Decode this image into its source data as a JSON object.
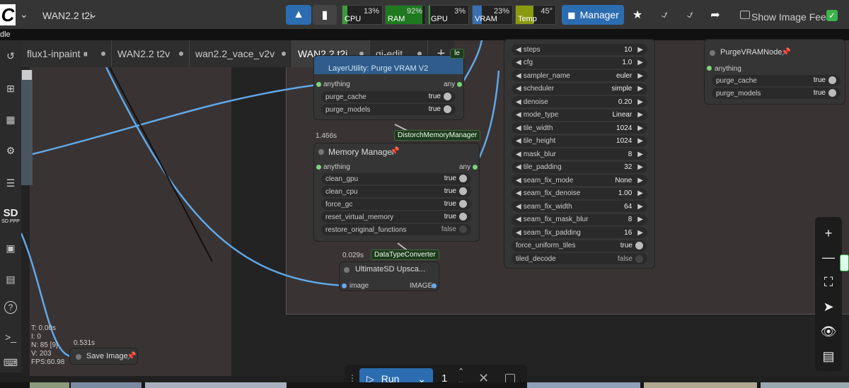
{
  "topbar": {
    "workflow_title": "WAN2.2 t2i",
    "manager_label": "Manager",
    "show_image_feed_label": "Show Image Feed",
    "meters": [
      {
        "label": "CPU",
        "value": "13%",
        "level": 0.13,
        "color": "#3a9a3a"
      },
      {
        "label": "RAM",
        "value": "92%",
        "level": 0.92,
        "color": "#1f7a1f"
      },
      {
        "label": "GPU",
        "value": "3%",
        "level": 0.03,
        "color": "#3a9a3a"
      },
      {
        "label": "VRAM",
        "value": "23%",
        "level": 0.23,
        "color": "#3a6fb0"
      },
      {
        "label": "Temp",
        "value": "45°",
        "level": 0.45,
        "color": "#8a9a10"
      }
    ],
    "strip_label": "dle"
  },
  "tabs": [
    {
      "label": "flux1-inpaint ⏸"
    },
    {
      "label": "WAN2.2 t2v"
    },
    {
      "label": "wan2.2_vace_v2v"
    },
    {
      "label": "WAN2.2 t2i"
    },
    {
      "label": "qi-edit"
    }
  ],
  "tab_add": "+",
  "sidebar_badge": "SD PPP",
  "nodes": {
    "purge_vram_v2": {
      "title": "LayerUtility: Purge VRAM V2",
      "input": "anything",
      "output": "any",
      "rows": [
        {
          "name": "purge_cache",
          "value": "true"
        },
        {
          "name": "purge_models",
          "value": "true"
        }
      ]
    },
    "memory_manager": {
      "time": "1.466s",
      "tag": "DistorchMemoryManager",
      "title": "Memory Manager",
      "input": "anything",
      "output": "any",
      "rows": [
        {
          "name": "clean_gpu",
          "value": "true",
          "on": true
        },
        {
          "name": "clean_cpu",
          "value": "true",
          "on": true
        },
        {
          "name": "force_gc",
          "value": "true",
          "on": true
        },
        {
          "name": "reset_virtual_memory",
          "value": "true",
          "on": true
        },
        {
          "name": "restore_original_functions",
          "value": "false",
          "on": false
        }
      ]
    },
    "upscale": {
      "time": "0.029s",
      "tag": "DataTypeConverter",
      "title": "UltimateSD Upsca...",
      "input": "image",
      "output": "IMAGE"
    },
    "usd_params": {
      "rows": [
        {
          "name": "steps",
          "value": "10"
        },
        {
          "name": "cfg",
          "value": "1.0"
        },
        {
          "name": "sampler_name",
          "value": "euler"
        },
        {
          "name": "scheduler",
          "value": "simple"
        },
        {
          "name": "denoise",
          "value": "0.20"
        },
        {
          "name": "mode_type",
          "value": "Linear"
        },
        {
          "name": "tile_width",
          "value": "1024"
        },
        {
          "name": "tile_height",
          "value": "1024"
        },
        {
          "name": "mask_blur",
          "value": "8"
        },
        {
          "name": "tile_padding",
          "value": "32"
        },
        {
          "name": "seam_fix_mode",
          "value": "None"
        },
        {
          "name": "seam_fix_denoise",
          "value": "1.00"
        },
        {
          "name": "seam_fix_width",
          "value": "64"
        },
        {
          "name": "seam_fix_mask_blur",
          "value": "8"
        },
        {
          "name": "seam_fix_padding",
          "value": "16"
        }
      ],
      "toggles": [
        {
          "name": "force_uniform_tiles",
          "value": "true",
          "on": true
        },
        {
          "name": "tiled_decode",
          "value": "false",
          "on": false
        }
      ]
    },
    "purge_vram_node": {
      "title": "PurgeVRAMNode",
      "input": "anything",
      "rows": [
        {
          "name": "purge_cache",
          "value": "true"
        },
        {
          "name": "purge_models",
          "value": "true"
        }
      ]
    },
    "save_image": {
      "time": "0.531s",
      "title": "Save Image"
    }
  },
  "stats": {
    "t": "T: 0.00s",
    "i": "I: 0",
    "n": "N: 85 [9]",
    "v": "V: 203",
    "fps": "FPS:60.98"
  },
  "run_bar": {
    "run_label": "Run",
    "count": "1"
  }
}
